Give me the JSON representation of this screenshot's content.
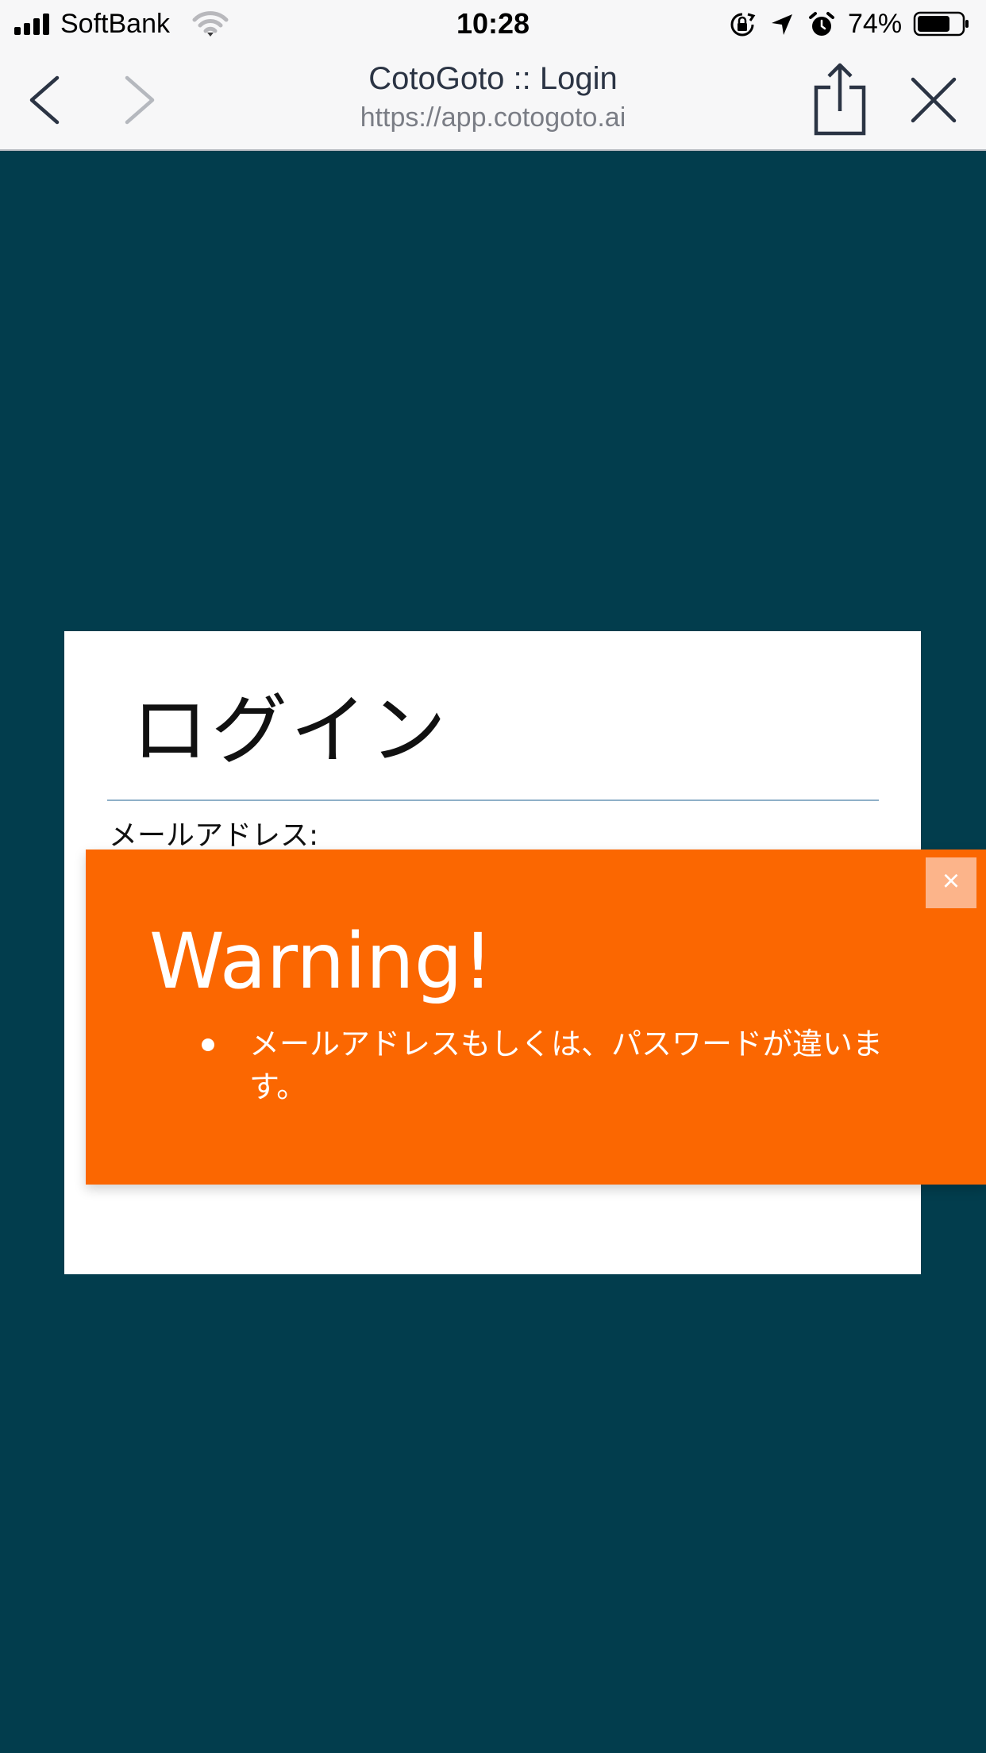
{
  "status_bar": {
    "carrier": "SoftBank",
    "time": "10:28",
    "battery_percent": "74%",
    "battery_level": 0.74,
    "icons": [
      "signal-icon",
      "wifi-icon",
      "orientation-lock-icon",
      "location-icon",
      "alarm-icon",
      "battery-icon"
    ]
  },
  "browser": {
    "title": "CotoGoto :: Login",
    "url": "https://app.cotogoto.ai",
    "icons": [
      "back-icon",
      "forward-icon",
      "share-icon",
      "close-icon"
    ]
  },
  "login": {
    "title": "ログイン",
    "email_label": "メールアドレス:"
  },
  "alert": {
    "title": "Warning!",
    "close_label": "×",
    "messages": [
      "メールアドレスもしくは、パスワードが違います。"
    ]
  },
  "colors": {
    "page_background": "#023d4d",
    "card_background": "#ffffff",
    "alert_background": "#fb6701",
    "alert_close_background": "#fcb48a",
    "divider": "#8fb0c8",
    "chrome_background": "#f7f7f8"
  }
}
